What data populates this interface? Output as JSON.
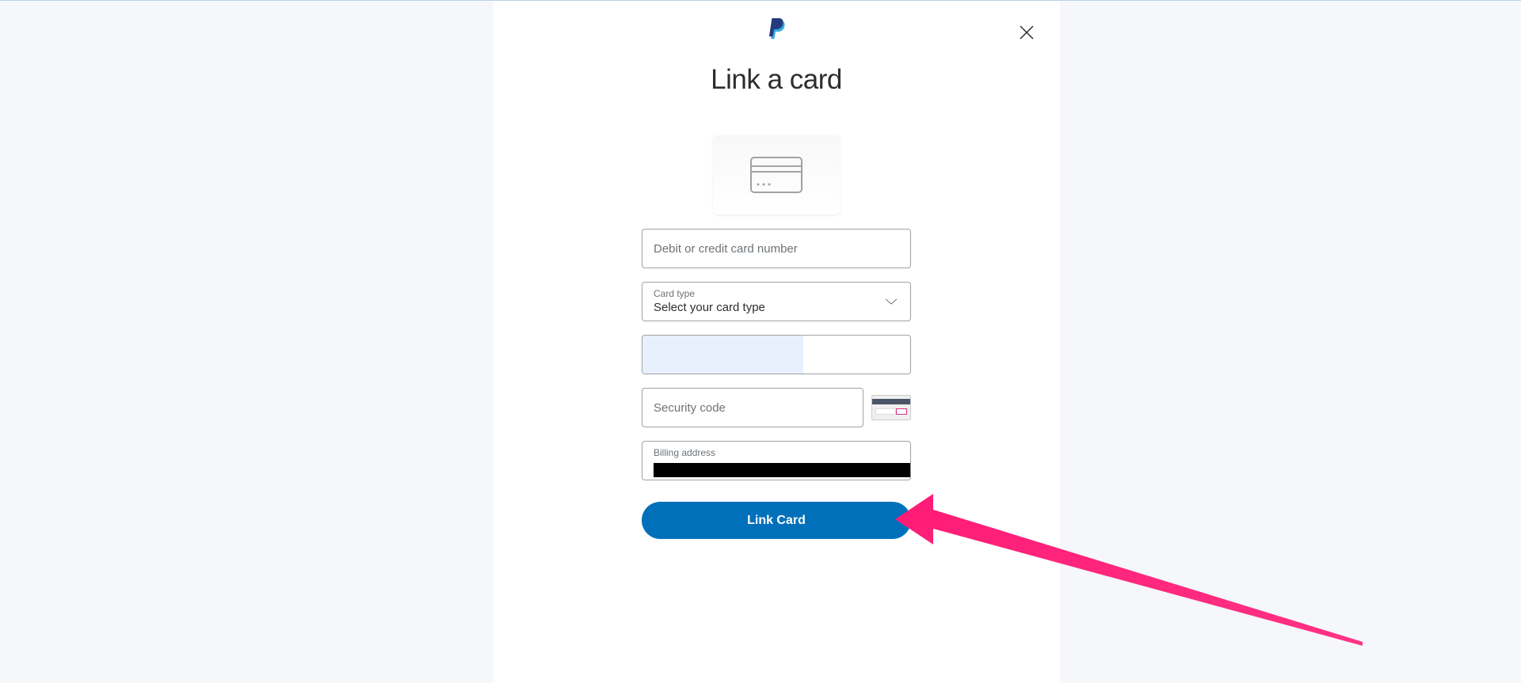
{
  "header": {
    "title": "Link a card"
  },
  "form": {
    "card_number_placeholder": "Debit or credit card number",
    "card_type_label": "Card type",
    "card_type_value": "Select your card type",
    "security_code_placeholder": "Security code",
    "billing_address_label": "Billing address"
  },
  "actions": {
    "link_card_label": "Link Card"
  }
}
